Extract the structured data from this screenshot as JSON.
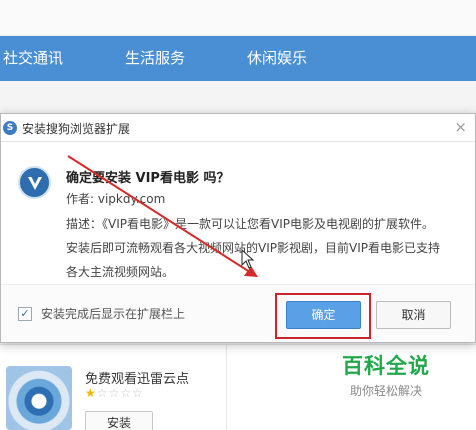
{
  "nav": {
    "items": [
      "社交通讯",
      "生活服务",
      "休闲娱乐"
    ],
    "color": "#4a8fd4"
  },
  "dialog": {
    "title": "安装搜狗浏览器扩展",
    "close_symbol": "×",
    "icon": "sogou-browser-icon",
    "extension_icon": "vip-extension-icon",
    "confirm_title": "确定要安装 VIP看电影 吗？",
    "author": "作者: vipkdy.com",
    "description_lines": [
      "描述：《VIP看电影》是一款可以让您看VIP电影及电视剧的扩展软件。",
      "安装后即可流畅观看各大视频网站的VIP影视剧，目前VIP看电影已支持",
      "各大主流视频网站。"
    ],
    "checkbox_label": "安装完成后显示在扩展栏上",
    "checkbox_checked": true,
    "ok_label": "确定",
    "cancel_label": "取消",
    "highlight_color": "#c8262a"
  },
  "background_app": {
    "title": "免费观看迅雷云点",
    "rating": 1,
    "rating_max": 5,
    "install_label": "安装"
  },
  "watermark": {
    "title": "百科全说",
    "subtitle": "助你轻松解决",
    "color": "#22a84a"
  }
}
